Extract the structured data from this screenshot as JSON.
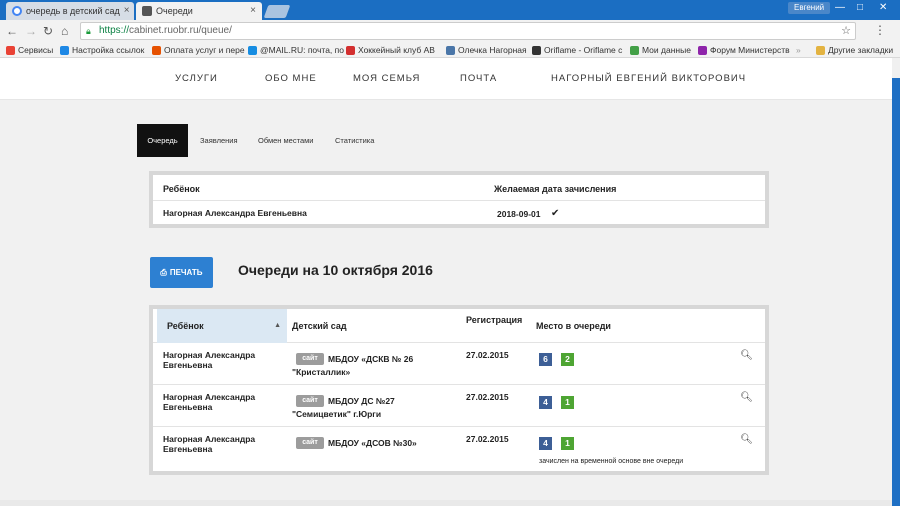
{
  "browser": {
    "tabs": [
      {
        "title": "очередь в детский сад",
        "active": false
      },
      {
        "title": "Очереди",
        "active": true
      }
    ],
    "profile": "Евгений",
    "url_scheme": "https://",
    "url_rest": "cabinet.ruobr.ru/queue/",
    "bookmarks": [
      {
        "label": "Сервисы",
        "color": "#e94235"
      },
      {
        "label": "Настройка ссылок",
        "color": "#1e88e5"
      },
      {
        "label": "Оплата услуг и пере",
        "color": "#e65100"
      },
      {
        "label": "@MAIL.RU: почта, по",
        "color": "#168de2"
      },
      {
        "label": "Хоккейный клуб АВ",
        "color": "#d32f2f"
      },
      {
        "label": "Олечка Нагорная",
        "color": "#4a76a8"
      },
      {
        "label": "Oriflame - Oriflame c",
        "color": "#333333"
      },
      {
        "label": "Мои данные",
        "color": "#43a047"
      },
      {
        "label": "Форум Министерств",
        "color": "#8e24aa"
      }
    ],
    "other_bookmarks": "Другие закладки"
  },
  "site_nav": {
    "items": [
      "УСЛУГИ",
      "ОБО МНЕ",
      "МОЯ СЕМЬЯ",
      "ПОЧТА",
      "НАГОРНЫЙ ЕВГЕНИЙ ВИКТОРОВИЧ"
    ]
  },
  "subtabs": [
    "Очередь",
    "Заявления",
    "Обмен местами",
    "Статистика"
  ],
  "desired_table": {
    "headers": [
      "Ребёнок",
      "Желаемая дата зачисления"
    ],
    "rows": [
      {
        "child": "Нагорная Александра Евгеньевна",
        "date": "2018-09-01",
        "check": "✔"
      }
    ]
  },
  "print_label": "ПЕЧАТЬ",
  "queue_title": "Очереди на 10 октября 2016",
  "queue_table": {
    "headers": [
      "Ребёнок",
      "Детский сад",
      "Регистрация",
      "Место в очереди"
    ],
    "site_badge": "сайт",
    "rows": [
      {
        "child": "Нагорная Александра Евгеньевна",
        "kg_line1": "МБДОУ «ДСКВ № 26",
        "kg_line2": "\"Кристаллик»",
        "reg": "27.02.2015",
        "pos1": "6",
        "pos2": "2",
        "note": ""
      },
      {
        "child": "Нагорная Александра Евгеньевна",
        "kg_line1": "МБДОУ ДС №27",
        "kg_line2": "\"Семицветик\" г.Юрги",
        "reg": "27.02.2015",
        "pos1": "4",
        "pos2": "1",
        "note": ""
      },
      {
        "child": "Нагорная Александра Евгеньевна",
        "kg_line1": "МБДОУ «ДСОВ №30»",
        "kg_line2": "",
        "reg": "27.02.2015",
        "pos1": "4",
        "pos2": "1",
        "note": "зачислен на временной основе вне очереди"
      }
    ]
  },
  "colors": {
    "accent": "#2d80d2",
    "queue_blue": "#3d5f96",
    "queue_green": "#4ea533"
  }
}
